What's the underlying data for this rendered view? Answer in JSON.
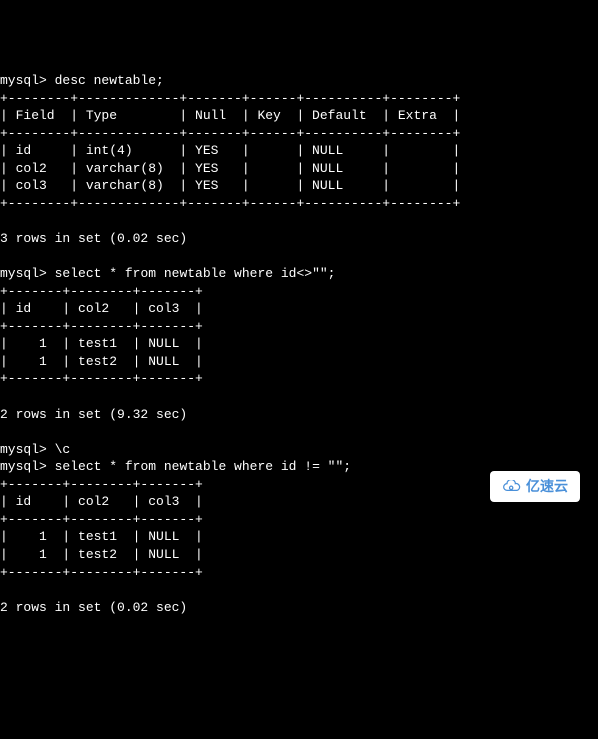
{
  "prompt": "mysql>",
  "cmd1": "desc newtable;",
  "desc_sep": "+--------+-------------+-------+------+----------+--------+",
  "desc_header": "| Field  | Type        | Null  | Key  | Default  | Extra  |",
  "desc_rows": [
    "| id     | int(4)      | YES   |      | NULL     |        |",
    "| col2   | varchar(8)  | YES   |      | NULL     |        |",
    "| col3   | varchar(8)  | YES   |      | NULL     |        |"
  ],
  "desc_result": "3 rows in set (0.02 sec)",
  "cmd2": "select * from newtable where id<>\"\";",
  "sel_sep": "+-------+--------+-------+",
  "sel_header": "| id    | col2   | col3  |",
  "sel_rows": [
    "|    1  | test1  | NULL  |",
    "|    1  | test2  | NULL  |"
  ],
  "sel_result1": "2 rows in set (9.32 sec)",
  "cmd3": "\\c",
  "cmd4": "select * from newtable where id != \"\";",
  "sel_result2": "2 rows in set (0.02 sec)",
  "watermark": "亿速云",
  "chart_data": {
    "type": "table",
    "desc_table": {
      "columns": [
        "Field",
        "Type",
        "Null",
        "Key",
        "Default",
        "Extra"
      ],
      "rows": [
        [
          "id",
          "int(4)",
          "YES",
          "",
          "NULL",
          ""
        ],
        [
          "col2",
          "varchar(8)",
          "YES",
          "",
          "NULL",
          ""
        ],
        [
          "col3",
          "varchar(8)",
          "YES",
          "",
          "NULL",
          ""
        ]
      ]
    },
    "select_table": {
      "columns": [
        "id",
        "col2",
        "col3"
      ],
      "rows": [
        [
          1,
          "test1",
          "NULL"
        ],
        [
          1,
          "test2",
          "NULL"
        ]
      ]
    }
  }
}
